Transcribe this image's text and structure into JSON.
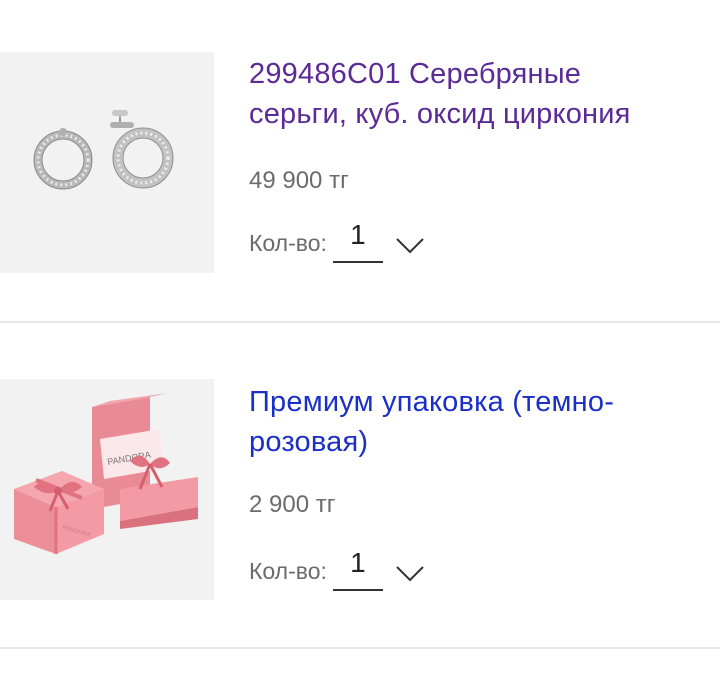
{
  "cart": {
    "items": [
      {
        "title_line1": "299486C01 Серебряные",
        "title_line2": "серьги, куб. оксид циркония",
        "price": "49 900 тг",
        "qty_label": "Кол-во:",
        "qty_value": "1",
        "image_icon": "earrings-image",
        "title_color": "#5b2a96"
      },
      {
        "title_line1": "Премиум упаковка (темно-",
        "title_line2": "розовая)",
        "price": "2 900 тг",
        "qty_label": "Кол-во:",
        "qty_value": "1",
        "image_icon": "gift-box-image",
        "image_text": "PANDORA",
        "title_color": "#1a2fc7"
      }
    ]
  }
}
